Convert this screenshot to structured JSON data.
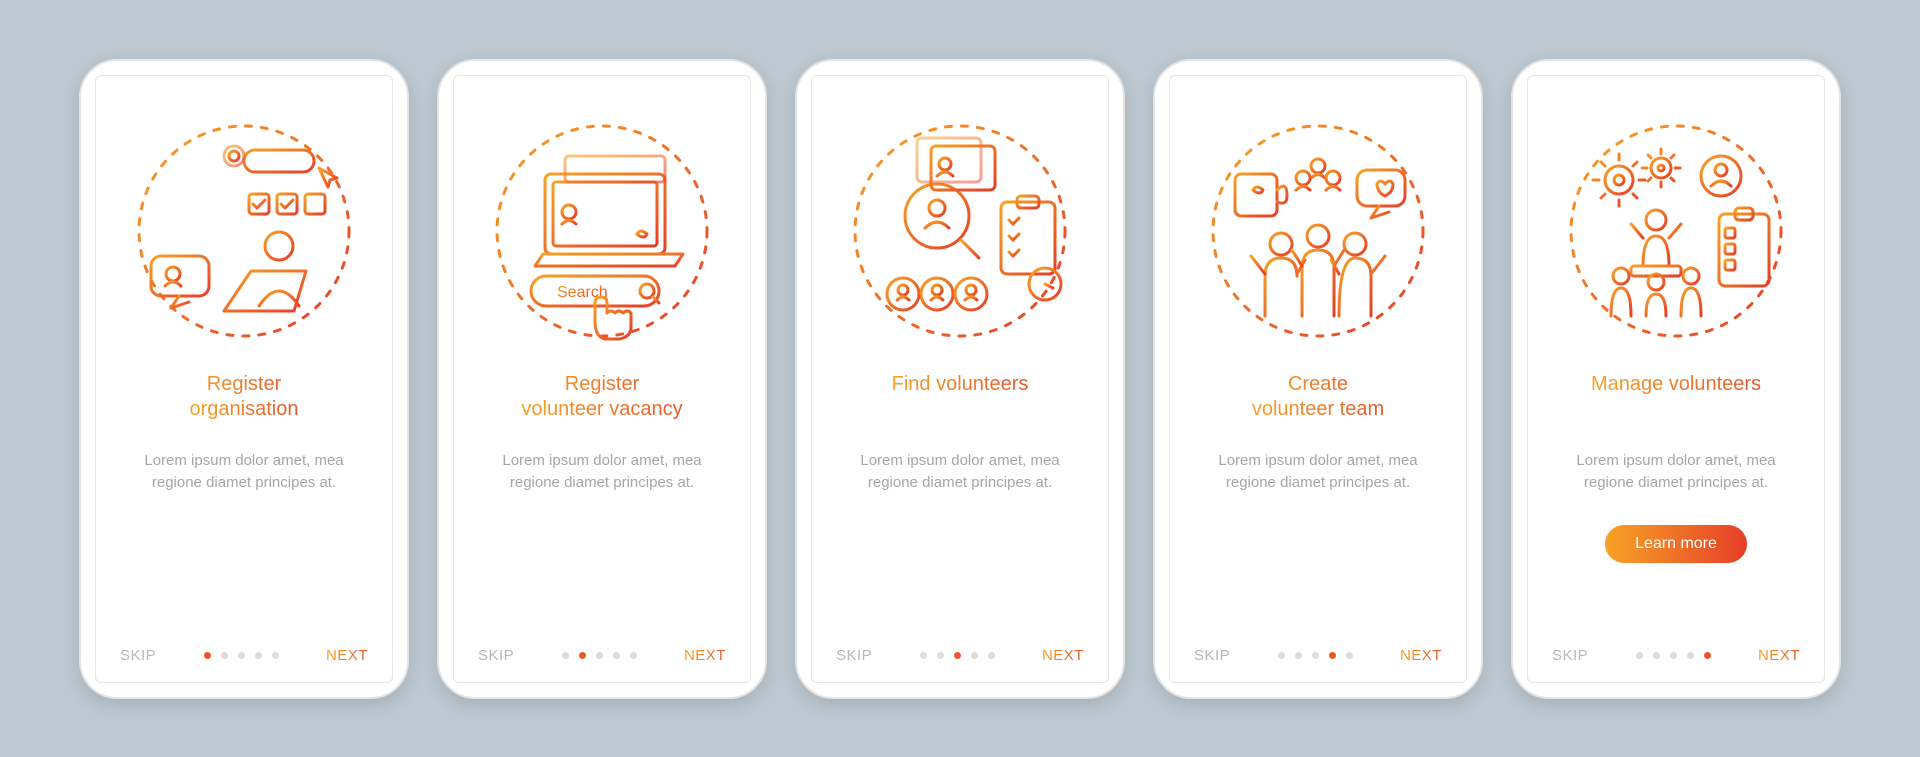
{
  "common": {
    "skip": "SKIP",
    "next": "NEXT",
    "learn_more": "Learn more",
    "search_label": "Search"
  },
  "screens": [
    {
      "title": "Register\norganisation",
      "desc": "Lorem ipsum dolor amet, mea regione diamet principes at.",
      "active_dot": 0,
      "icon": "register-org-icon"
    },
    {
      "title": "Register\nvolunteer vacancy",
      "desc": "Lorem ipsum dolor amet, mea regione diamet principes at.",
      "active_dot": 1,
      "icon": "register-vacancy-icon"
    },
    {
      "title": "Find volunteers",
      "desc": "Lorem ipsum dolor amet, mea regione diamet principes at.",
      "active_dot": 2,
      "icon": "find-volunteers-icon"
    },
    {
      "title": "Create\nvolunteer team",
      "desc": "Lorem ipsum dolor amet, mea regione diamet principes at.",
      "active_dot": 3,
      "icon": "create-team-icon"
    },
    {
      "title": "Manage volunteers",
      "desc": "Lorem ipsum dolor amet, mea regione diamet principes at.",
      "active_dot": 4,
      "icon": "manage-volunteers-icon",
      "cta": true
    }
  ],
  "colors": {
    "grad_start": "#f7a326",
    "grad_end": "#e63e29",
    "bg": "#bdc8d1",
    "muted": "#a6a6a6"
  }
}
